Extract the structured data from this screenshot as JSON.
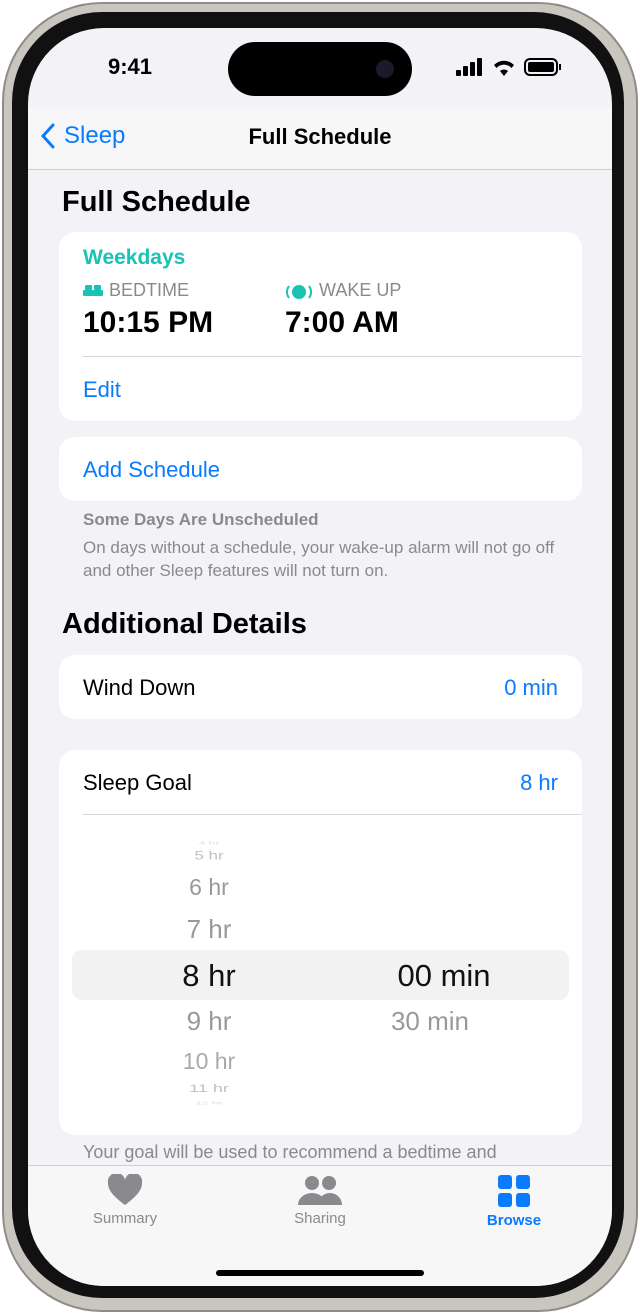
{
  "status": {
    "time": "9:41"
  },
  "nav": {
    "back_label": "Sleep",
    "title": "Full Schedule"
  },
  "schedule": {
    "heading": "Full Schedule",
    "group": "Weekdays",
    "bedtime_label": "BEDTIME",
    "bedtime": "10:15 PM",
    "wake_label": "WAKE UP",
    "wake": "7:00 AM",
    "edit": "Edit"
  },
  "add_schedule": "Add Schedule",
  "note": {
    "title": "Some Days Are Unscheduled",
    "text": "On days without a schedule, your wake-up alarm will not go off and other Sleep features will not turn on."
  },
  "details": {
    "heading": "Additional Details",
    "wind_down_label": "Wind Down",
    "wind_down_value": "0 min",
    "sleep_goal_label": "Sleep Goal",
    "sleep_goal_value": "8 hr"
  },
  "picker": {
    "hours": [
      "4 hr",
      "5 hr",
      "6 hr",
      "7 hr",
      "8 hr",
      "9 hr",
      "10 hr",
      "11 hr",
      "12 hr"
    ],
    "minutes": [
      "00 min",
      "30 min"
    ],
    "selected_hour": "8 hr",
    "selected_minute": "00 min"
  },
  "footer_text": "Your goal will be used to recommend a bedtime and",
  "tabs": [
    {
      "label": "Summary",
      "icon": "heart-icon"
    },
    {
      "label": "Sharing",
      "icon": "people-icon"
    },
    {
      "label": "Browse",
      "icon": "grid-icon",
      "active": true
    }
  ],
  "colors": {
    "accent": "#0a7aff",
    "teal": "#19c3b4"
  }
}
